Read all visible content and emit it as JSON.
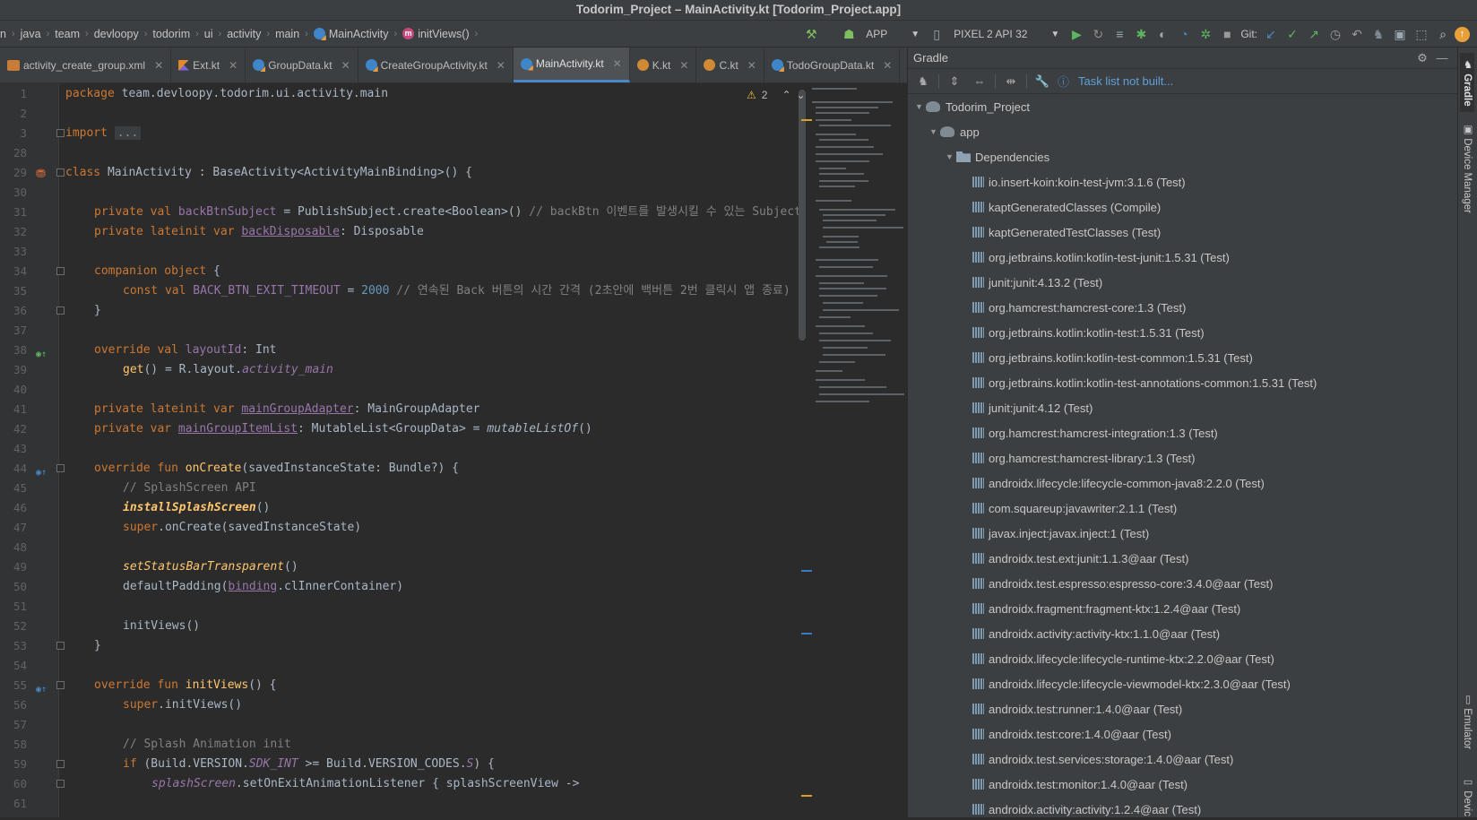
{
  "window": {
    "title": "Todorim_Project – MainActivity.kt [Todorim_Project.app]"
  },
  "breadcrumbs": [
    "n",
    "java",
    "team",
    "devloopy",
    "todorim",
    "ui",
    "activity",
    "main",
    "MainActivity",
    "initViews()"
  ],
  "toolbar": {
    "config_label": "APP",
    "device_label": "PIXEL 2 API 32",
    "git_label": "Git:"
  },
  "tabs": [
    {
      "label": "activity_create_group.xml",
      "icon": "xml-file-icon",
      "active": false
    },
    {
      "label": "Ext.kt",
      "icon": "kotlin-file-icon",
      "active": false
    },
    {
      "label": "GroupData.kt",
      "icon": "kotlin-class-icon",
      "active": false
    },
    {
      "label": "CreateGroupActivity.kt",
      "icon": "kotlin-class-icon",
      "active": false
    },
    {
      "label": "MainActivity.kt",
      "icon": "kotlin-class-icon",
      "active": true
    },
    {
      "label": "K.kt",
      "icon": "kotlin-object-icon",
      "active": false
    },
    {
      "label": "C.kt",
      "icon": "kotlin-object-icon",
      "active": false
    },
    {
      "label": "TodoGroupData.kt",
      "icon": "kotlin-class-icon",
      "active": false
    }
  ],
  "editor": {
    "warning_count": "2",
    "line_numbers": [
      "1",
      "2",
      "3",
      "28",
      "29",
      "30",
      "31",
      "32",
      "33",
      "34",
      "35",
      "36",
      "37",
      "38",
      "39",
      "40",
      "41",
      "42",
      "43",
      "44",
      "45",
      "46",
      "47",
      "48",
      "49",
      "50",
      "51",
      "52",
      "53",
      "54",
      "55",
      "56",
      "57",
      "58",
      "59",
      "60",
      "61"
    ],
    "code": {
      "l1_a": "package",
      "l1_b": " team.devloopy.todorim.ui.activity.main",
      "l3_a": "import",
      "l3_b": "...",
      "l29_a": "class",
      "l29_b": " MainActivity : BaseActivity<ActivityMainBinding>() {",
      "l31_a": "private val ",
      "l31_b": "backBtnSubject",
      "l31_c": " = PublishSubject.create<Boolean>() ",
      "l31_d": "// backBtn 이벤트를 발생시킬 수 있는 Subject",
      "l32_a": "private lateinit var ",
      "l32_b": "backDisposable",
      "l32_c": ": Disposable",
      "l34_a": "companion object",
      "l34_b": " {",
      "l35_a": "const val ",
      "l35_b": "BACK_BTN_EXIT_TIMEOUT",
      "l35_c": " = ",
      "l35_d": "2000",
      "l35_e": " // 연속된 Back 버튼의 시간 간격 (2초안에 백버튼 2번 클릭시 앱 종료)",
      "l36": "}",
      "l38_a": "override val ",
      "l38_b": "layoutId",
      "l38_c": ": Int",
      "l39_a": "get",
      "l39_b": "() = R.layout.",
      "l39_c": "activity_main",
      "l41_a": "private lateinit var ",
      "l41_b": "mainGroupAdapter",
      "l41_c": ": MainGroupAdapter",
      "l42_a": "private var ",
      "l42_b": "mainGroupItemList",
      "l42_c": ": MutableList<GroupData> = ",
      "l42_d": "mutableListOf",
      "l42_e": "()",
      "l44_a": "override fun ",
      "l44_b": "onCreate",
      "l44_c": "(savedInstanceState: Bundle?) {",
      "l45": "// SplashScreen API",
      "l46_a": "installSplashScreen",
      "l46_b": "()",
      "l47_a": "super",
      "l47_b": ".onCreate(savedInstanceState)",
      "l49_a": "setStatusBarTransparent",
      "l49_b": "()",
      "l50_a": "defaultPadding(",
      "l50_b": "binding",
      "l50_c": ".clInnerContainer)",
      "l52": "initViews()",
      "l53": "}",
      "l55_a": "override fun ",
      "l55_b": "initViews",
      "l55_c": "() {",
      "l56_a": "super",
      "l56_b": ".initViews()",
      "l58": "// Splash Animation init",
      "l59_a": "if",
      "l59_b": " (Build.VERSION.",
      "l59_c": "SDK_INT",
      "l59_d": " >= Build.VERSION_CODES.",
      "l59_e": "S",
      "l59_f": ") {",
      "l60_a": "splashScreen",
      "l60_b": ".setOnExitAnimationListener { splashScreenView ->"
    }
  },
  "gradle": {
    "title": "Gradle",
    "tasks_status": "Task list not built...",
    "root": "Todorim_Project",
    "module": "app",
    "dependencies_label": "Dependencies",
    "dependencies": [
      "io.insert-koin:koin-test-jvm:3.1.6 (Test)",
      "kaptGeneratedClasses (Compile)",
      "kaptGeneratedTestClasses (Test)",
      "org.jetbrains.kotlin:kotlin-test-junit:1.5.31 (Test)",
      "junit:junit:4.13.2 (Test)",
      "org.hamcrest:hamcrest-core:1.3 (Test)",
      "org.jetbrains.kotlin:kotlin-test:1.5.31 (Test)",
      "org.jetbrains.kotlin:kotlin-test-common:1.5.31 (Test)",
      "org.jetbrains.kotlin:kotlin-test-annotations-common:1.5.31 (Test)",
      "junit:junit:4.12 (Test)",
      "org.hamcrest:hamcrest-integration:1.3 (Test)",
      "org.hamcrest:hamcrest-library:1.3 (Test)",
      "androidx.lifecycle:lifecycle-common-java8:2.2.0 (Test)",
      "com.squareup:javawriter:2.1.1 (Test)",
      "javax.inject:javax.inject:1 (Test)",
      "androidx.test.ext:junit:1.1.3@aar (Test)",
      "androidx.test.espresso:espresso-core:3.4.0@aar (Test)",
      "androidx.fragment:fragment-ktx:1.2.4@aar (Test)",
      "androidx.activity:activity-ktx:1.1.0@aar (Test)",
      "androidx.lifecycle:lifecycle-runtime-ktx:2.2.0@aar (Test)",
      "androidx.lifecycle:lifecycle-viewmodel-ktx:2.3.0@aar (Test)",
      "androidx.test:runner:1.4.0@aar (Test)",
      "androidx.test:core:1.4.0@aar (Test)",
      "androidx.test.services:storage:1.4.0@aar (Test)",
      "androidx.test:monitor:1.4.0@aar (Test)",
      "androidx.activity:activity:1.2.4@aar (Test)"
    ]
  },
  "right_tool_windows": {
    "gradle": "Gradle",
    "device_manager": "Device Manager",
    "emulator": "Emulator",
    "device_file": "Devic"
  },
  "colors": {
    "accent": "#4a88c7",
    "keyword": "#cc7832",
    "function": "#ffc66d",
    "comment": "#808080",
    "number": "#6897bb",
    "property": "#9876aa"
  }
}
